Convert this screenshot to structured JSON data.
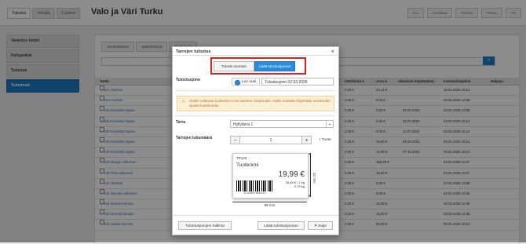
{
  "topbar": {
    "tabs": [
      "Tuksitus",
      "Vertailu",
      "Tuotteet"
    ],
    "title": "Valo ja Väri Turku",
    "actions": [
      "Tuo",
      "Muokkaa",
      "Tulosta",
      "Poista",
      "Vie"
    ]
  },
  "sidebar": {
    "items": [
      "Varaston tiedot",
      "Hyllypaikat",
      "Tulostus",
      "Toiminnot"
    ]
  },
  "content": {
    "filters": [
      "Varastotilanne",
      "Saldohistoria",
      "Tuotetyypit"
    ],
    "search_placeholder": "",
    "columns": [
      "Tuote",
      "Ostohinta €",
      "Arvo €",
      "Viimeisin käyttöpäivä",
      "Inventointipäivä",
      "Hälytys"
    ],
    "rows": [
      {
        "name": "TP121 Avoimet",
        "p1": "2,00 €",
        "p2": "22,12 €",
        "d1": "",
        "d2": "18.03.2025 15:12",
        "x": ""
      },
      {
        "name": "TP122 Avoimet",
        "p1": "2,00 €",
        "p2": "0,00 €",
        "d1": "",
        "d2": "02.02.2025 12:08",
        "x": ""
      },
      {
        "name": "TP130 Kromattu hopea",
        "p1": "2,00 €",
        "p2": "0,00 €",
        "d1": "01.07.2023",
        "d2": "02.02.2025 12:08",
        "x": ""
      },
      {
        "name": "TP130 Kromattu hopea",
        "p1": "2,00 €",
        "p2": "0,00 €",
        "d1": "11.07.2023",
        "d2": "02.02.2025 15:12",
        "x": ""
      },
      {
        "name": "TP130 Kromattu hopea",
        "p1": "2,00 €",
        "p2": "6,00 €",
        "d1": "11.07.2023",
        "d2": "02.02.2025 15:12",
        "x": ""
      },
      {
        "name": "TP130 Kromattu hopea",
        "p1": "2,00 €",
        "p2": "36,00 €",
        "d1": "04.09.2023",
        "d2": "02.02.2025 15:12",
        "x": ""
      },
      {
        "name": "TP130 Kromattu hopea",
        "p1": "2,00 €",
        "p2": "14,00 €",
        "d1": "07.10.2023",
        "d2": "02.02.2025 15:12",
        "x": ""
      },
      {
        "name": "TP130 Design valkoinen",
        "p1": "2,00 €",
        "p2": "196,00 €",
        "d1": "",
        "d2": "04.03.2025 11:57",
        "x": ""
      },
      {
        "name": "TP130 Flow valkoinen",
        "p1": "2,00 €",
        "p2": "44,00 €",
        "d1": "",
        "d2": "02.02.2025 11:57",
        "x": ""
      },
      {
        "name": "TP131 Harmaa",
        "p1": "2,00 €",
        "p2": "0,00 €",
        "d1": "",
        "d2": "23.02.2025 12:58",
        "x": ""
      },
      {
        "name": "TP131 harmaa valkoinen",
        "p1": "2,00 €",
        "p2": "8,00 €",
        "d1": "",
        "d2": "02.02.2025 12:58",
        "x": ""
      },
      {
        "name": "TP131 tumma harmaa",
        "p1": "2,00 €",
        "p2": "42,00 €",
        "d1": "",
        "d2": "10.02.2025 11:58",
        "x": ""
      },
      {
        "name": "TP131 tumma harmaa",
        "p1": "2,00 €",
        "p2": "44,00 €",
        "d1": "",
        "d2": "02.02.2025 12:58",
        "x": ""
      },
      {
        "name": "TP132 vaalea harmaa",
        "p1": "2,00 €",
        "p2": "56,00 €",
        "d1": "",
        "d2": "09.01.2025 15:12",
        "x": ""
      }
    ]
  },
  "modal": {
    "title": "Tarrojen tulostus",
    "mode_print_direct": "Tulosta suoraan",
    "mode_add_queue": "Lisää tulostusjonoon",
    "queue_label": "Tulostusjono",
    "radio_new": "Luo uusi",
    "queue_name": "Tulostusjono 02.03.2026",
    "warning": "Osalle valituista tuotteista ei ole asetettu viivakoodia. Näille tuotteille käytetään viivakoodin sijasta tuotekoodia.",
    "label_tag": "Tarra",
    "label_value": "Hyllytarra 1",
    "count_label": "Tarrojen lukumäärä",
    "count_value": "1",
    "per_product": "/ Tuote",
    "preview": {
      "sku": "TP123",
      "name": "Tuotenimi",
      "price": "19,99 €",
      "unit_price": "26,65 € / 1 kg",
      "weight": "0,75 kg",
      "barcode": "1234567890123",
      "width": "58 mm",
      "height": "32 mm"
    },
    "btn_manage": "Tulostusjonojen hallinta",
    "btn_add": "Lisää tulostusjonoon",
    "btn_close": "Sulje",
    "close_glyph": "×"
  }
}
